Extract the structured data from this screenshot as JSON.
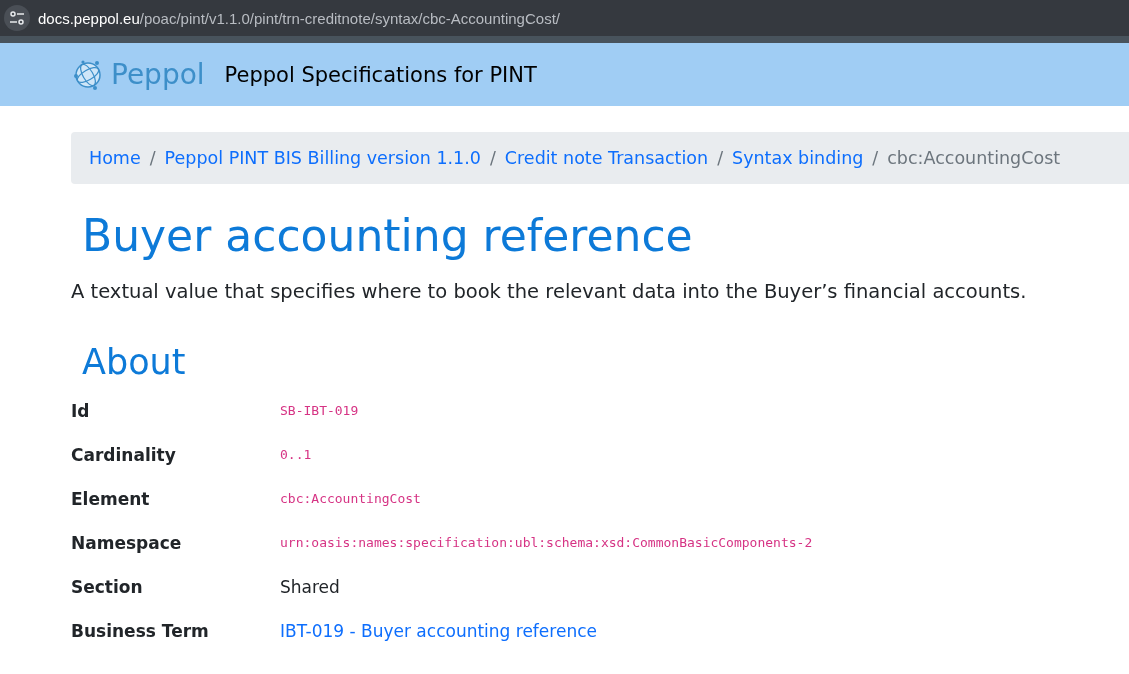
{
  "address_bar": {
    "host": "docs.peppol.eu",
    "path": "/poac/pint/v1.1.0/pint/trn-creditnote/syntax/cbc-AccountingCost/"
  },
  "header": {
    "logo_text": "Peppol",
    "title": "Peppol Specifications for PINT"
  },
  "breadcrumb": [
    {
      "label": "Home",
      "kind": "link"
    },
    {
      "separator_before": "/",
      "label": "Peppol PINT BIS Billing version 1.1.0",
      "kind": "link"
    },
    {
      "separator_before": "/",
      "label": "Credit note Transaction",
      "kind": "link"
    },
    {
      "separator_before": "/",
      "label": "Syntax binding",
      "kind": "link"
    },
    {
      "separator_before": "/",
      "label": "cbc:AccountingCost",
      "kind": "current"
    }
  ],
  "page_title": "Buyer accounting reference",
  "description": "A textual value that specifies where to book the relevant data into the Buyer’s financial accounts.",
  "about": {
    "heading": "About",
    "properties": [
      {
        "label": "Id",
        "value": "SB-IBT-019",
        "kind": "code"
      },
      {
        "label": "Cardinality",
        "value": "0..1",
        "kind": "code"
      },
      {
        "label": "Element",
        "value": "cbc:AccountingCost",
        "kind": "code"
      },
      {
        "label": "Namespace",
        "value": "urn:oasis:names:specification:ubl:schema:xsd:CommonBasicComponents-2",
        "kind": "code"
      },
      {
        "label": "Section",
        "value": "Shared",
        "kind": "text"
      },
      {
        "label": "Business Term",
        "value": "IBT-019 - Buyer accounting reference",
        "kind": "link"
      }
    ]
  }
}
